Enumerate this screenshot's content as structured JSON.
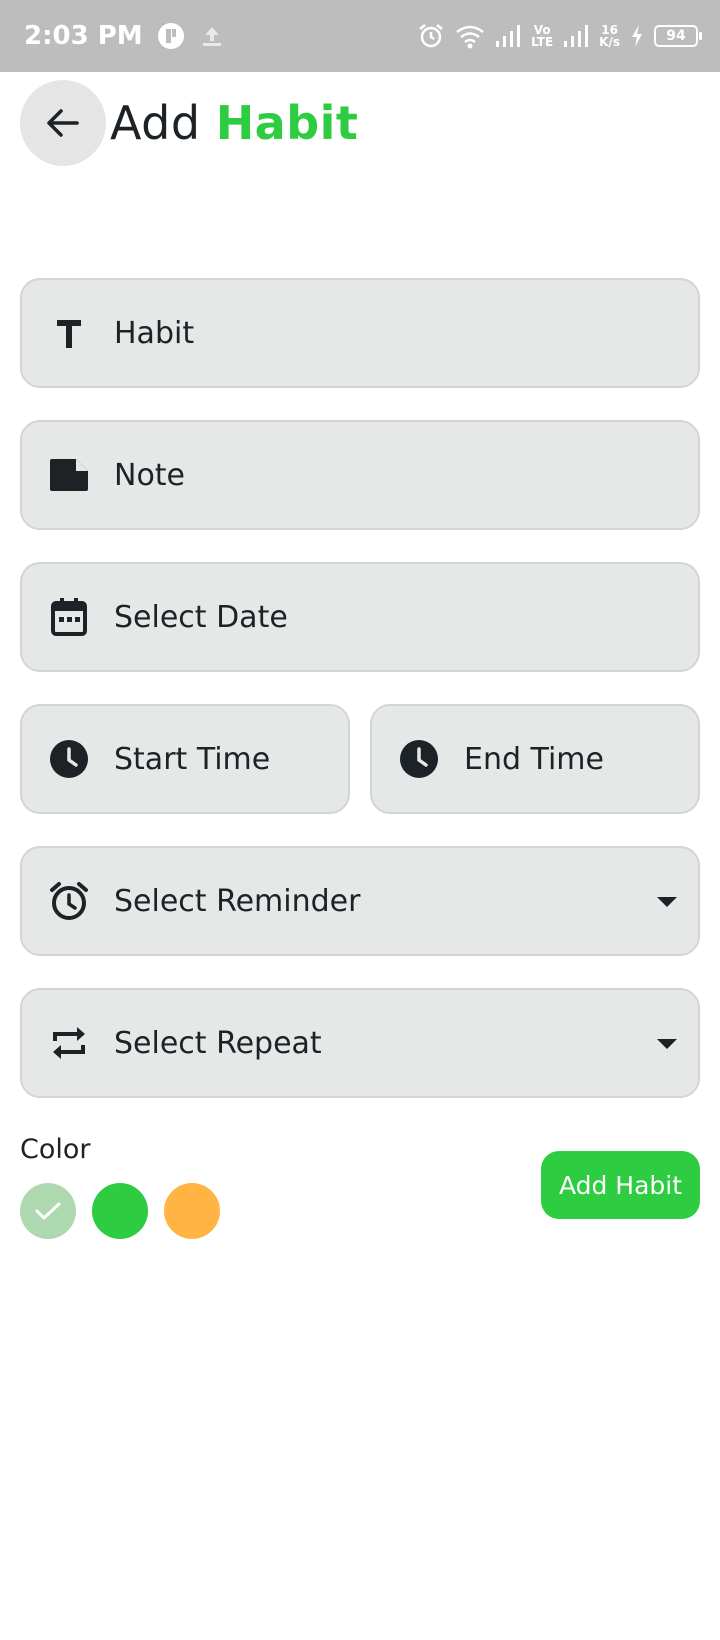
{
  "status_bar": {
    "time": "2:03 PM",
    "network_speed_value": "16",
    "network_speed_unit": "K/s",
    "volte": "Vo",
    "lte": "LTE",
    "battery": "94"
  },
  "header": {
    "title_prefix": "Add",
    "title_accent": "Habit",
    "accent_color": "#2ecc40"
  },
  "form": {
    "habit_placeholder": "Habit",
    "note_placeholder": "Note",
    "date_placeholder": "Select Date",
    "start_time_placeholder": "Start Time",
    "end_time_placeholder": "End Time",
    "reminder_placeholder": "Select Reminder",
    "repeat_placeholder": "Select Repeat"
  },
  "color_picker": {
    "label": "Color",
    "swatches": [
      {
        "name": "light-green",
        "color": "#aed9b0",
        "selected": true
      },
      {
        "name": "green",
        "color": "#2ecc40",
        "selected": false
      },
      {
        "name": "orange",
        "color": "#ffb443",
        "selected": false
      }
    ]
  },
  "actions": {
    "add_habit_label": "Add Habit"
  },
  "icons": {
    "back": "arrow-left-icon",
    "habit": "text-icon",
    "note": "note-icon",
    "date": "calendar-icon",
    "time": "clock-icon",
    "reminder": "alarm-icon",
    "repeat": "repeat-icon",
    "dropdown": "caret-down-icon"
  }
}
